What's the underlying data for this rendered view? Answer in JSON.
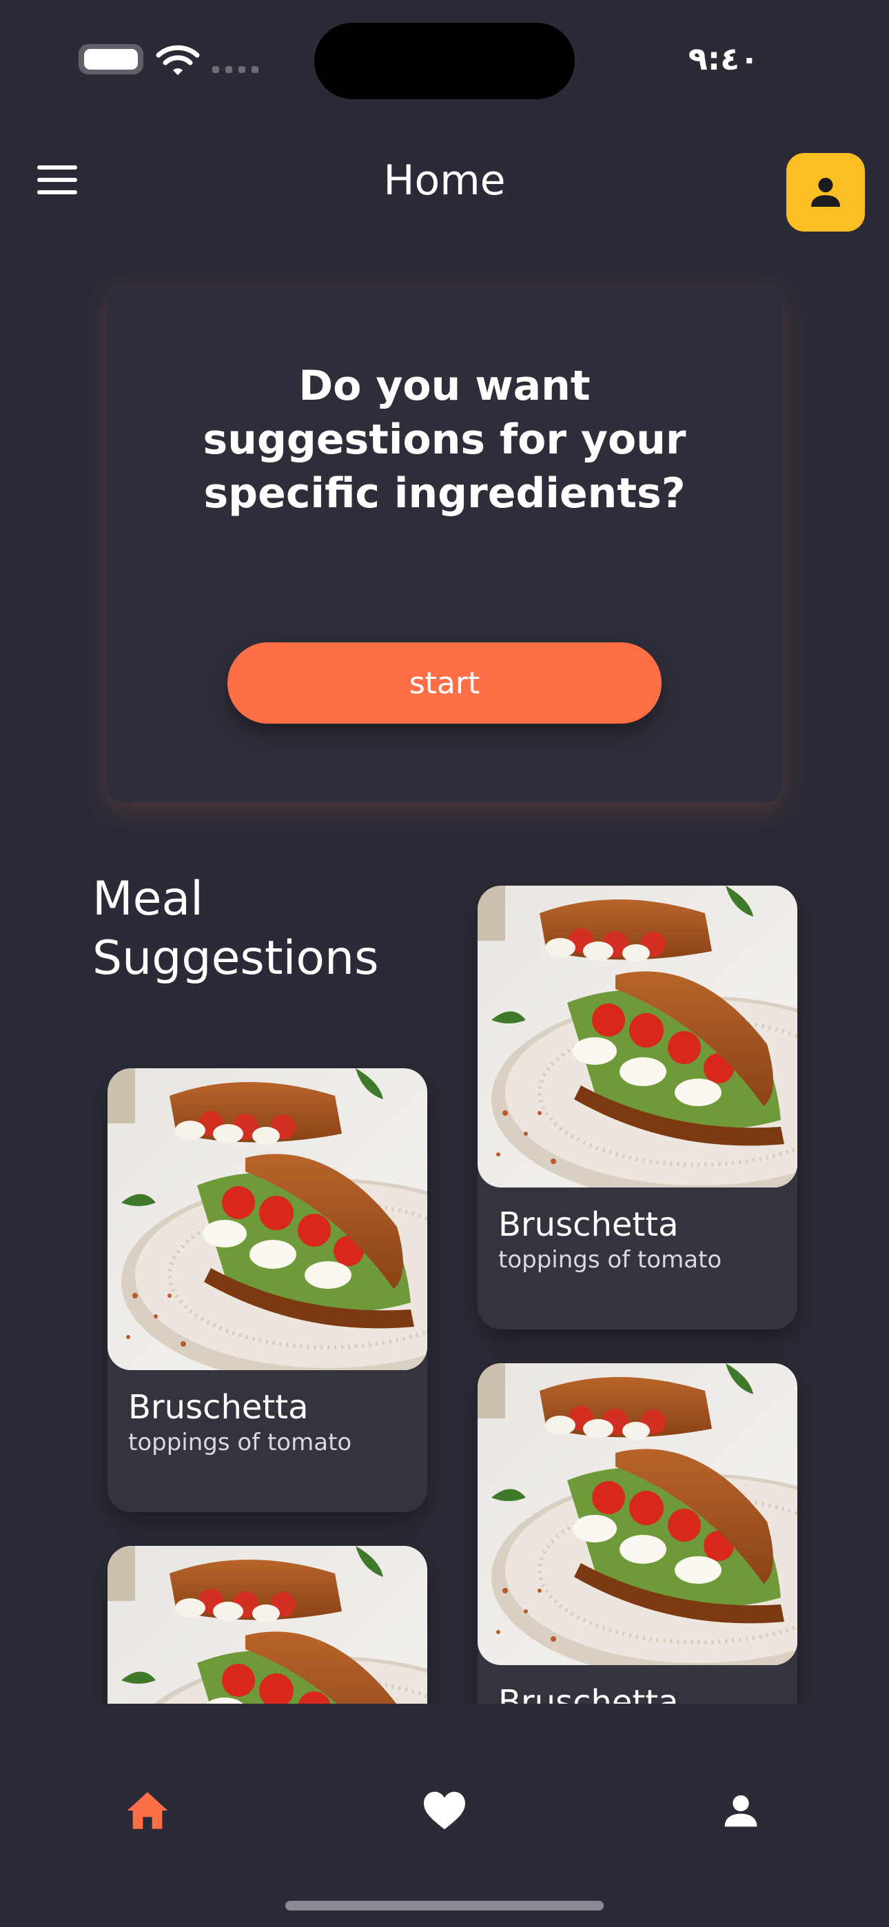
{
  "status_bar": {
    "time": "٩:٤٠",
    "icons": [
      "battery-icon",
      "wifi-icon",
      "cellular-signal-icon"
    ]
  },
  "header": {
    "title": "Home",
    "icons": [
      "menu-icon",
      "user-icon"
    ]
  },
  "question_card": {
    "question": "Do you want suggestions for your specific ingredients?",
    "start_label": "start"
  },
  "meal_suggestions": {
    "title": "Meal Suggestions",
    "cards": [
      {
        "name": "Bruschetta",
        "description": "toppings of tomato"
      },
      {
        "name": "Bruschetta",
        "description": "toppings of tomato"
      },
      {
        "name": "Bruschetta",
        "description": ""
      },
      {
        "name": "",
        "description": ""
      }
    ]
  },
  "bottom_nav": {
    "items": [
      {
        "icon": "home-icon",
        "active": true
      },
      {
        "icon": "heart-icon",
        "active": false
      },
      {
        "icon": "person-icon",
        "active": false
      }
    ]
  },
  "colors": {
    "background": "#2b2b37",
    "card": "#34343f",
    "accent": "#ff6f47",
    "profile_button": "#fbbf24",
    "text": "#ffffff"
  }
}
